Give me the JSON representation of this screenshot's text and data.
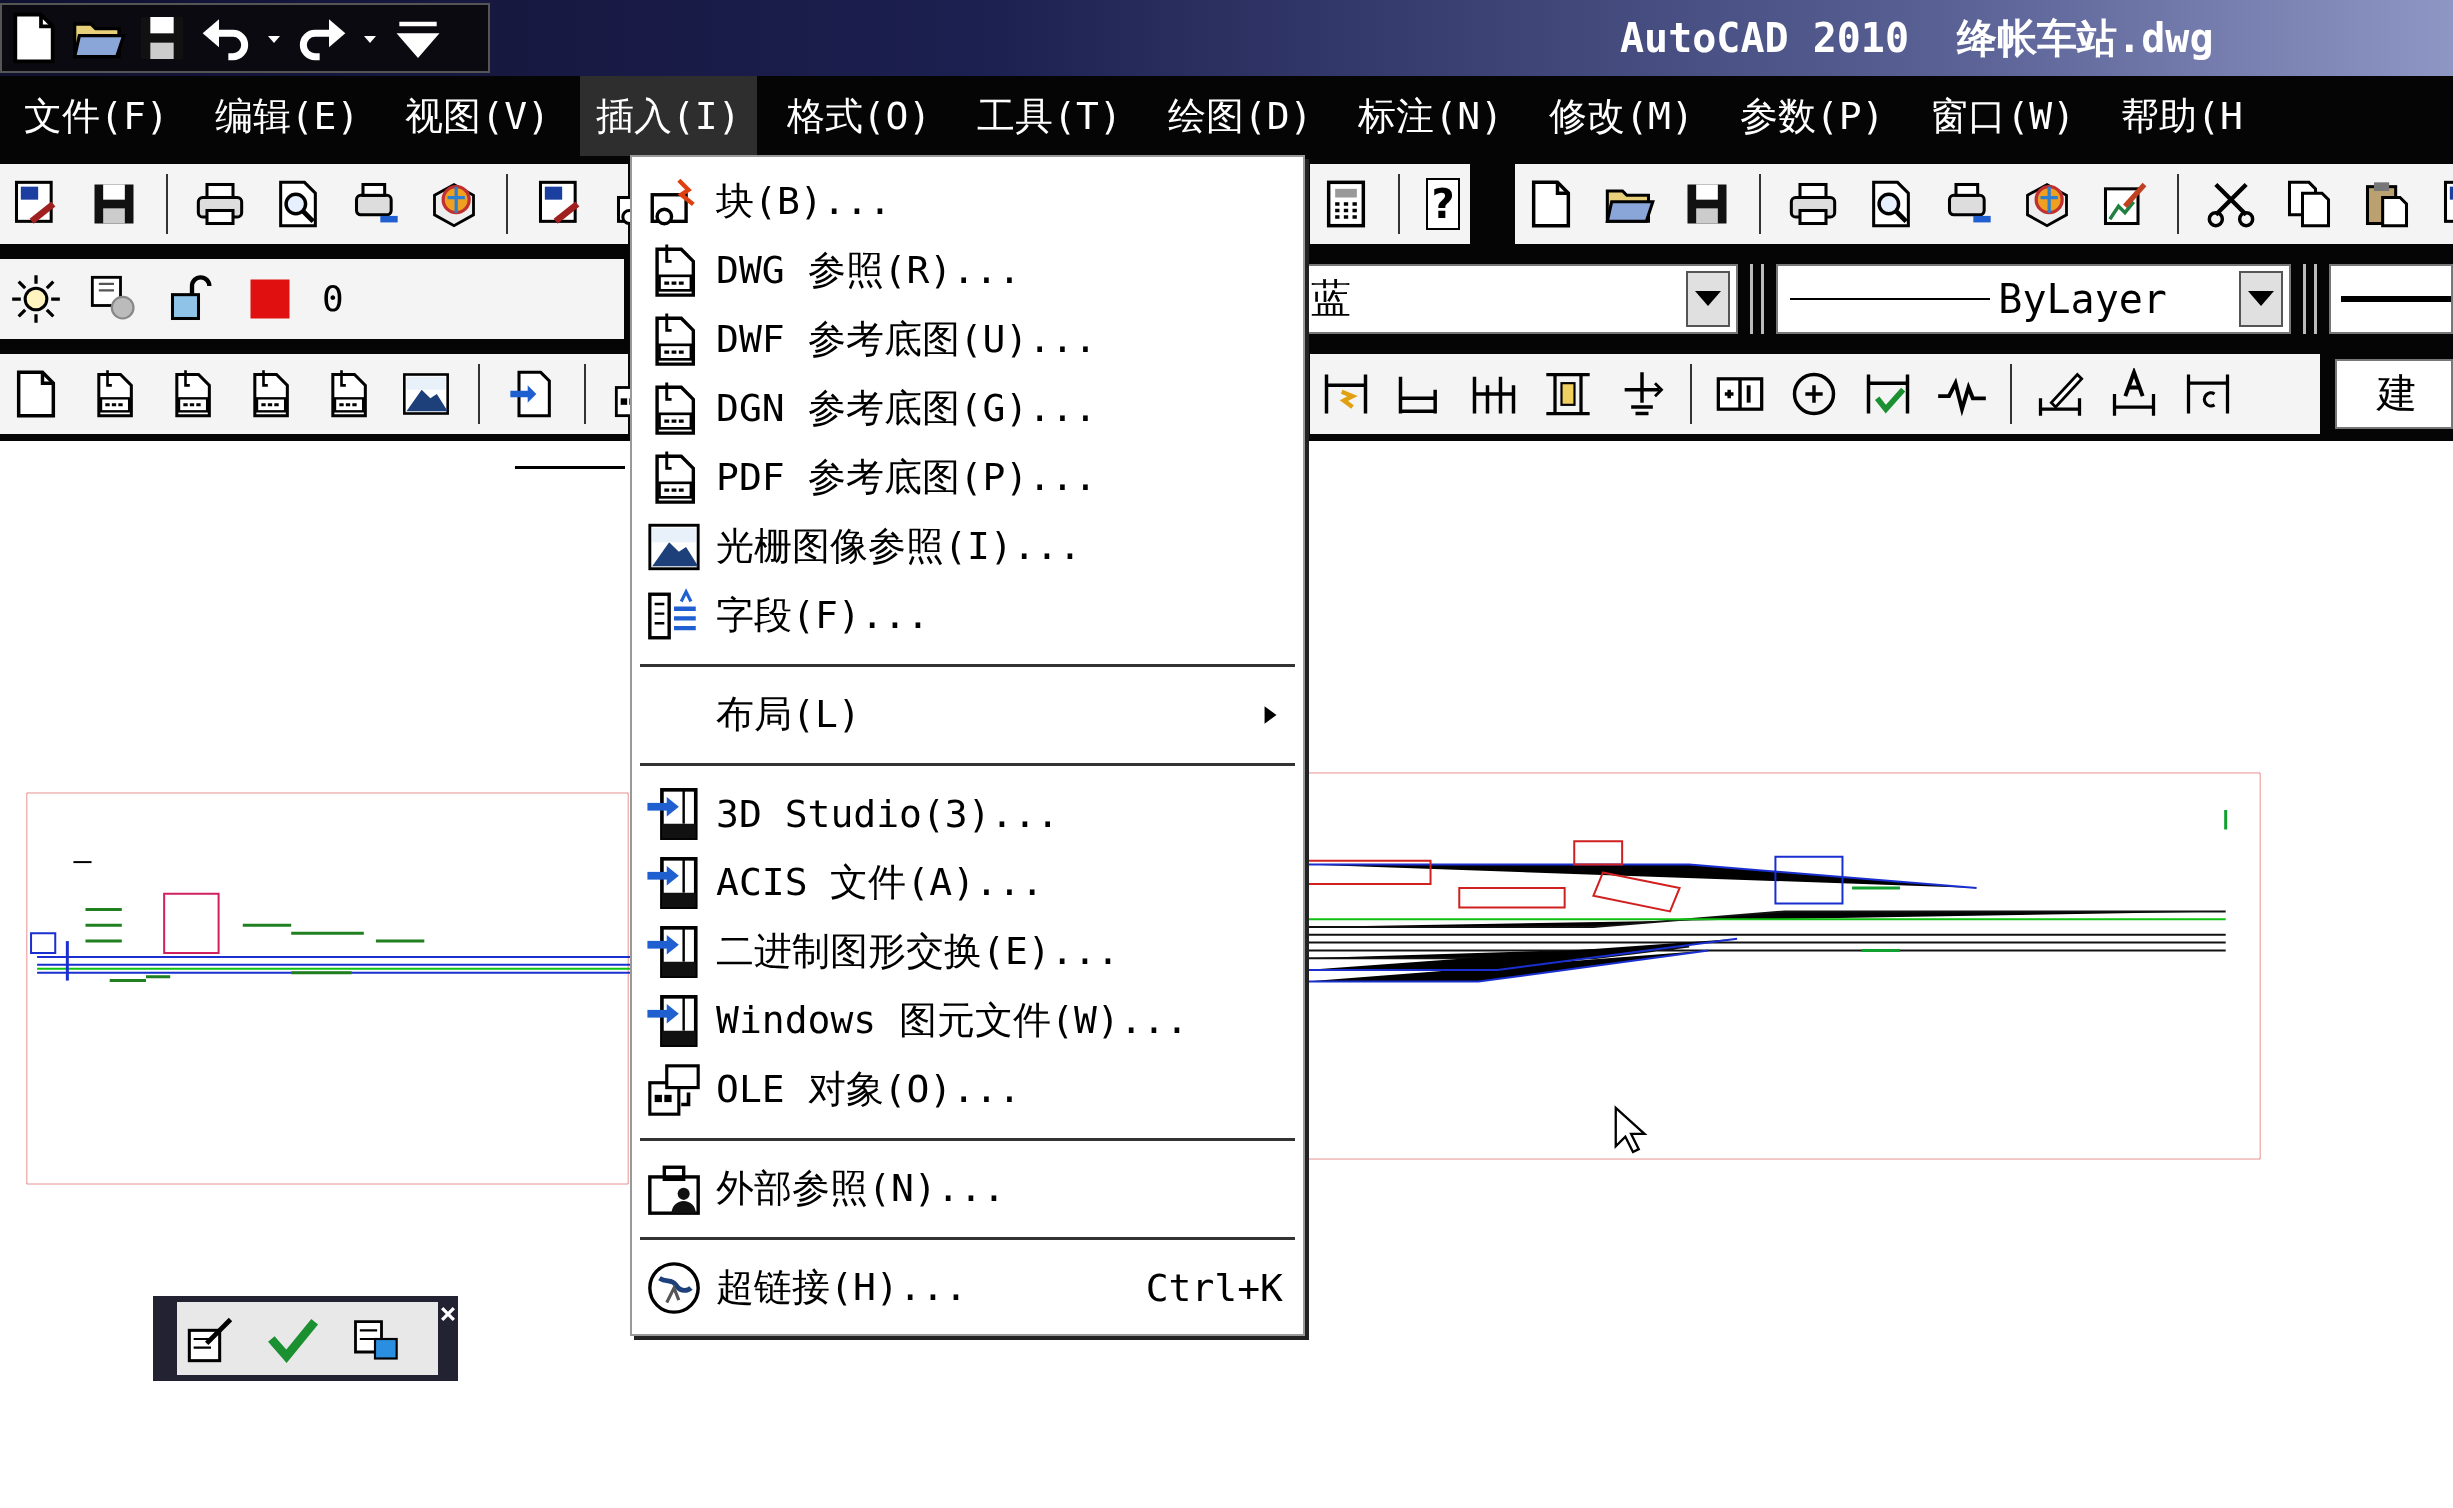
{
  "title_bar": {
    "title": "AutoCAD 2010  绛帐车站.dwg"
  },
  "menu_bar": [
    {
      "label": "文件(F)",
      "selected": false
    },
    {
      "label": "编辑(E)",
      "selected": false
    },
    {
      "label": "视图(V)",
      "selected": false
    },
    {
      "label": "插入(I)",
      "selected": true
    },
    {
      "label": "格式(O)",
      "selected": false
    },
    {
      "label": "工具(T)",
      "selected": false
    },
    {
      "label": "绘图(D)",
      "selected": false
    },
    {
      "label": "标注(N)",
      "selected": false
    },
    {
      "label": "修改(M)",
      "selected": false
    },
    {
      "label": "参数(P)",
      "selected": false
    },
    {
      "label": "窗口(W)",
      "selected": false
    },
    {
      "label": "帮助(H",
      "selected": false
    }
  ],
  "toolbars": {
    "help_button": "?",
    "layer_name": "0",
    "color_combo": "蓝",
    "linetype_combo": "ByLayer",
    "style_combo": "建"
  },
  "insert_menu": {
    "items": [
      {
        "kind": "item",
        "label": "块(B)..."
      },
      {
        "kind": "item",
        "label": "DWG 参照(R)..."
      },
      {
        "kind": "item",
        "label": "DWF 参考底图(U)..."
      },
      {
        "kind": "item",
        "label": "DGN 参考底图(G)..."
      },
      {
        "kind": "item",
        "label": "PDF 参考底图(P)..."
      },
      {
        "kind": "item",
        "label": "光栅图像参照(I)..."
      },
      {
        "kind": "item",
        "label": "字段(F)..."
      },
      {
        "kind": "separator"
      },
      {
        "kind": "submenu",
        "label": "布局(L)"
      },
      {
        "kind": "separator"
      },
      {
        "kind": "item",
        "label": "3D Studio(3)..."
      },
      {
        "kind": "item",
        "label": "ACIS 文件(A)..."
      },
      {
        "kind": "item",
        "label": "二进制图形交换(E)..."
      },
      {
        "kind": "item",
        "label": "Windows 图元文件(W)..."
      },
      {
        "kind": "item",
        "label": "OLE 对象(O)..."
      },
      {
        "kind": "separator"
      },
      {
        "kind": "item",
        "label": "外部参照(N)..."
      },
      {
        "kind": "separator"
      },
      {
        "kind": "item",
        "label": "超链接(H)...",
        "shortcut": "Ctrl+K"
      }
    ]
  }
}
